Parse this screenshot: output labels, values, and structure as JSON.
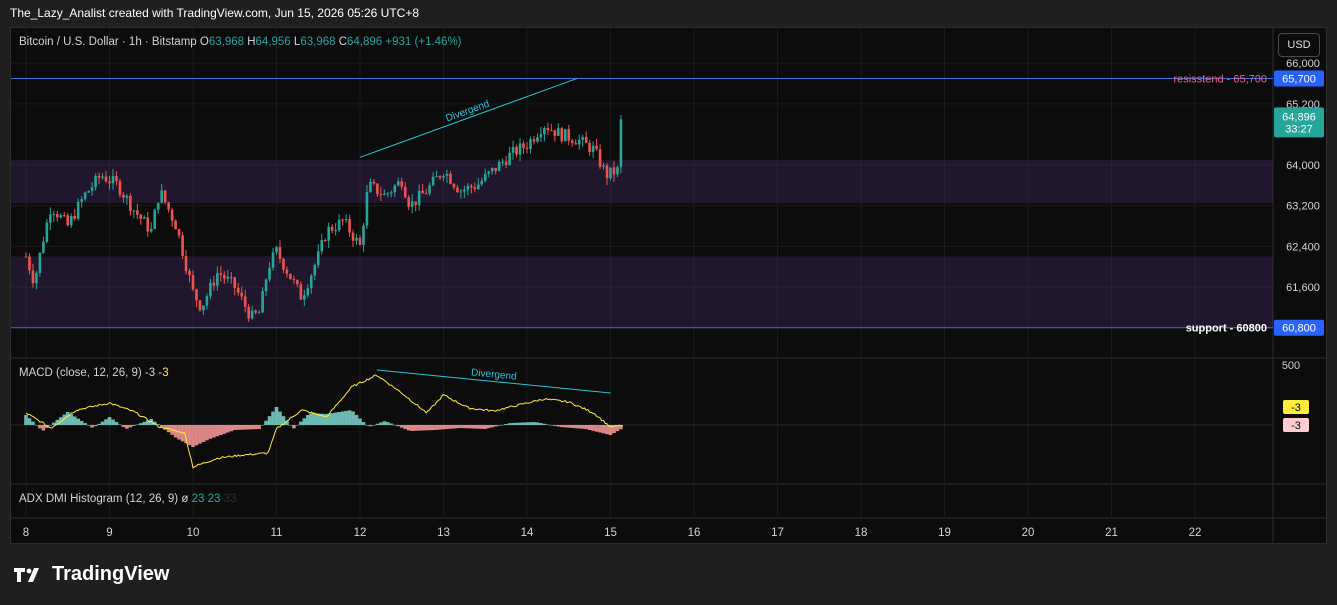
{
  "header": {
    "creator": "The_Lazy_Analist created with TradingView.com, Jun 15, 2026 05:26 UTC+8"
  },
  "symbol": {
    "title": "Bitcoin / U.S. Dollar · 1h · Bitstamp",
    "o_label": "O",
    "o": "63,968",
    "h_label": "H",
    "h": "64,956",
    "l_label": "L",
    "l": "63,968",
    "c_label": "C",
    "c": "64,896",
    "change": "+931 (+1.46%)"
  },
  "currency_button": "USD",
  "brand": "TradingView",
  "colors": {
    "up": "#26a69a",
    "down": "#ef5350",
    "zone": "#6a3fa0",
    "level_line": "#3f6fd8",
    "macd_line": "#ffeb3b",
    "trend_line": "#26c6da",
    "resist_label": "#f06292"
  },
  "chart_data": {
    "type": "candlestick",
    "x_axis": {
      "ticks": [
        "8",
        "9",
        "10",
        "11",
        "12",
        "13",
        "14",
        "15",
        "16",
        "17",
        "18",
        "19",
        "20",
        "21",
        "22"
      ]
    },
    "price_axis": {
      "ticks": [
        "66,000",
        "65,200",
        "64,000",
        "63,200",
        "62,400",
        "61,600",
        "60,800"
      ],
      "range": [
        60500,
        66200
      ]
    },
    "last_price": {
      "value": "64,896",
      "countdown": "33:27"
    },
    "levels": [
      {
        "name": "resisstend - 65,700",
        "value": 65700,
        "tag": "65,700"
      },
      {
        "name": "support - 60800",
        "value": 60800,
        "tag": "60,800"
      }
    ],
    "zones": [
      {
        "from": 63250,
        "to": 64100
      },
      {
        "from": 60800,
        "to": 62200
      }
    ],
    "annotations": [
      {
        "text": "Divergend",
        "pane": "price",
        "from": [
          "12",
          64150
        ],
        "to": [
          "14.6",
          65700
        ]
      },
      {
        "text": "Divergend",
        "pane": "macd",
        "from": [
          "12.2",
          550
        ],
        "to": [
          "15",
          320
        ]
      }
    ],
    "close_anchors": [
      [
        8.0,
        62200
      ],
      [
        8.1,
        61700
      ],
      [
        8.2,
        62500
      ],
      [
        8.3,
        63200
      ],
      [
        8.5,
        62800
      ],
      [
        8.7,
        63400
      ],
      [
        8.9,
        63800
      ],
      [
        9.1,
        63600
      ],
      [
        9.3,
        63100
      ],
      [
        9.5,
        62700
      ],
      [
        9.6,
        63500
      ],
      [
        9.8,
        62800
      ],
      [
        10.0,
        61500
      ],
      [
        10.1,
        61200
      ],
      [
        10.3,
        61900
      ],
      [
        10.5,
        61600
      ],
      [
        10.7,
        61000
      ],
      [
        10.8,
        61100
      ],
      [
        10.9,
        62000
      ],
      [
        11.0,
        62300
      ],
      [
        11.1,
        62000
      ],
      [
        11.3,
        61400
      ],
      [
        11.5,
        62200
      ],
      [
        11.6,
        62700
      ],
      [
        11.8,
        62900
      ],
      [
        12.0,
        62400
      ],
      [
        12.1,
        63600
      ],
      [
        12.3,
        63400
      ],
      [
        12.5,
        63700
      ],
      [
        12.6,
        63200
      ],
      [
        12.8,
        63500
      ],
      [
        13.0,
        63900
      ],
      [
        13.2,
        63500
      ],
      [
        13.4,
        63600
      ],
      [
        13.6,
        63900
      ],
      [
        13.8,
        64200
      ],
      [
        14.0,
        64400
      ],
      [
        14.2,
        64800
      ],
      [
        14.4,
        64600
      ],
      [
        14.6,
        64500
      ],
      [
        14.8,
        64300
      ],
      [
        14.95,
        63800
      ],
      [
        15.1,
        63900
      ],
      [
        15.15,
        64896
      ]
    ],
    "macd": {
      "name": "MACD (close, 12, 26, 9)",
      "value_1": "-3",
      "value_2": "-3",
      "axis_tick": "500",
      "tag_yellow": "-3",
      "tag_pink": "-3",
      "line_anchors": [
        [
          8.0,
          120
        ],
        [
          8.3,
          -30
        ],
        [
          8.6,
          150
        ],
        [
          9.0,
          220
        ],
        [
          9.3,
          130
        ],
        [
          9.6,
          -20
        ],
        [
          9.9,
          -80
        ],
        [
          10.0,
          -420
        ],
        [
          10.3,
          -330
        ],
        [
          10.6,
          -300
        ],
        [
          10.9,
          -280
        ],
        [
          11.0,
          -40
        ],
        [
          11.3,
          150
        ],
        [
          11.6,
          80
        ],
        [
          11.9,
          380
        ],
        [
          12.2,
          500
        ],
        [
          12.5,
          320
        ],
        [
          12.8,
          120
        ],
        [
          13.0,
          300
        ],
        [
          13.3,
          170
        ],
        [
          13.6,
          140
        ],
        [
          13.9,
          200
        ],
        [
          14.2,
          260
        ],
        [
          14.5,
          230
        ],
        [
          14.8,
          120
        ],
        [
          15.0,
          -20
        ],
        [
          15.15,
          -3
        ]
      ],
      "hist_anchors": [
        [
          8.0,
          100
        ],
        [
          8.2,
          -60
        ],
        [
          8.5,
          130
        ],
        [
          8.8,
          -30
        ],
        [
          9.0,
          80
        ],
        [
          9.2,
          -40
        ],
        [
          9.5,
          60
        ],
        [
          9.8,
          -130
        ],
        [
          10.0,
          -220
        ],
        [
          10.2,
          -140
        ],
        [
          10.5,
          -50
        ],
        [
          10.8,
          -40
        ],
        [
          11.0,
          180
        ],
        [
          11.2,
          -40
        ],
        [
          11.4,
          120
        ],
        [
          11.6,
          110
        ],
        [
          11.9,
          150
        ],
        [
          12.1,
          -20
        ],
        [
          12.3,
          40
        ],
        [
          12.6,
          -60
        ],
        [
          12.9,
          -50
        ],
        [
          13.2,
          -30
        ],
        [
          13.5,
          -40
        ],
        [
          13.8,
          20
        ],
        [
          14.1,
          30
        ],
        [
          14.4,
          -20
        ],
        [
          14.7,
          -40
        ],
        [
          15.0,
          -100
        ],
        [
          15.15,
          -30
        ]
      ]
    },
    "adx": {
      "name": "ADX DMI Histogram (12, 26, 9)",
      "symbol": "ø",
      "v1": "23",
      "v2": "23",
      "v3": "33"
    }
  }
}
